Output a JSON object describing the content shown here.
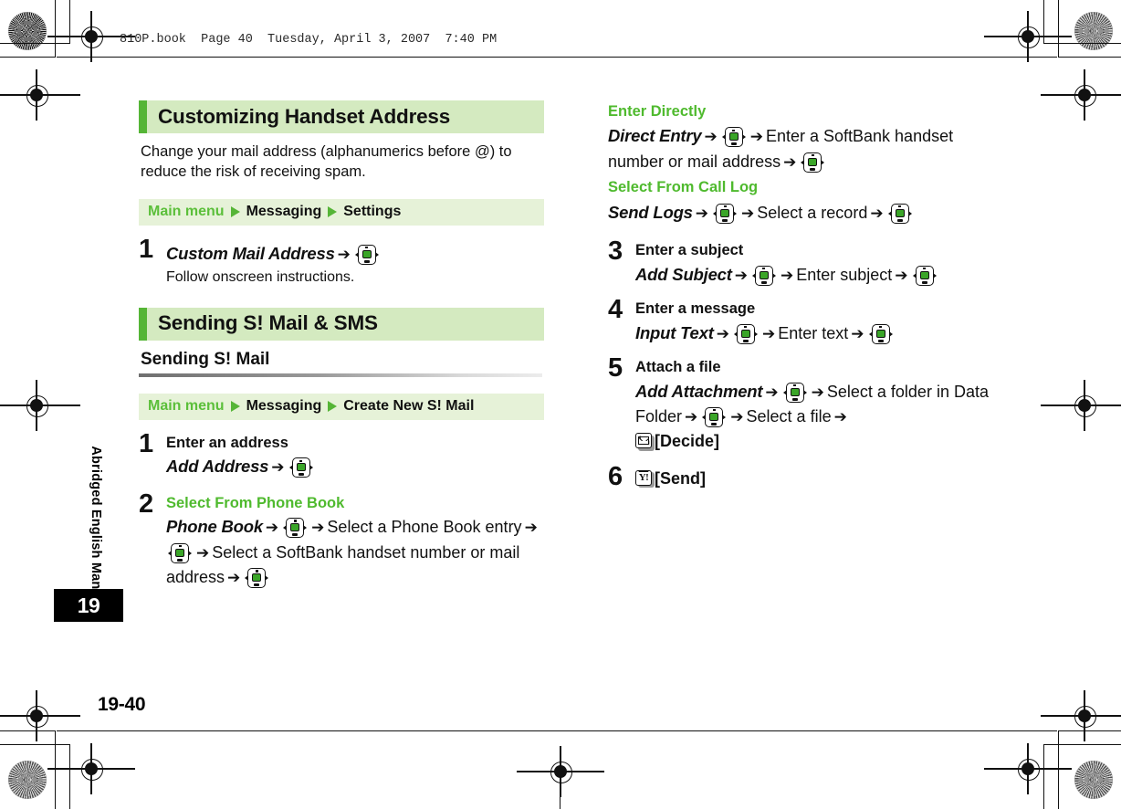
{
  "document": {
    "header_line": "810P.book  Page 40  Tuesday, April 3, 2007  7:40 PM",
    "page_number": "19-40",
    "side_tab_text": "Abridged English Manual",
    "chapter_number": "19"
  },
  "colors": {
    "accent_bar": "#55b536",
    "heading_band": "#d4eac0",
    "menu_band": "#e6f2d8",
    "green_text": "#4fba2e",
    "key_green": "#3aa528"
  },
  "icons": {
    "navigation_key": "navigation-key-icon",
    "mail_key": "envelope-key-icon",
    "yahoo_key": "yahoo-key-icon",
    "triangle": "play-triangle-icon"
  },
  "left_column": {
    "section1": {
      "heading": "Customizing Handset Address",
      "paragraph": "Change your mail address (alphanumerics before @) to reduce the risk of receiving spam.",
      "menu_path": {
        "root": "Main menu",
        "items": [
          "Messaging",
          "Settings"
        ]
      },
      "steps": [
        {
          "number": "1",
          "command": "Custom Mail Address",
          "note": "Follow onscreen instructions."
        }
      ]
    },
    "section2": {
      "heading": "Sending S! Mail & SMS",
      "subheading": "Sending S! Mail",
      "menu_path": {
        "root": "Main menu",
        "items": [
          "Messaging",
          "Create New S! Mail"
        ]
      },
      "steps": [
        {
          "number": "1",
          "title": "Enter an address",
          "command": "Add Address"
        },
        {
          "number": "2",
          "title": "Select From Phone Book",
          "command": "Phone Book",
          "frag1": "Select a Phone Book entry",
          "frag2": "Select a SoftBank handset number or mail address"
        }
      ]
    }
  },
  "right_column": {
    "continued_blocks": [
      {
        "label": "Enter Directly",
        "command": "Direct Entry",
        "fragment": "Enter a SoftBank handset number or mail address"
      },
      {
        "label": "Select From Call Log",
        "command": "Send Logs",
        "fragment": "Select a record"
      }
    ],
    "steps": [
      {
        "number": "3",
        "title": "Enter a subject",
        "command": "Add Subject",
        "fragment": "Enter subject"
      },
      {
        "number": "4",
        "title": "Enter a message",
        "command": "Input Text",
        "fragment": "Enter text"
      },
      {
        "number": "5",
        "title": "Attach a file",
        "command": "Add Attachment",
        "frag1": "Select a folder in Data Folder",
        "frag2": "Select a file",
        "decide_label": "[Decide]"
      },
      {
        "number": "6",
        "send_label": "[Send]"
      }
    ]
  }
}
